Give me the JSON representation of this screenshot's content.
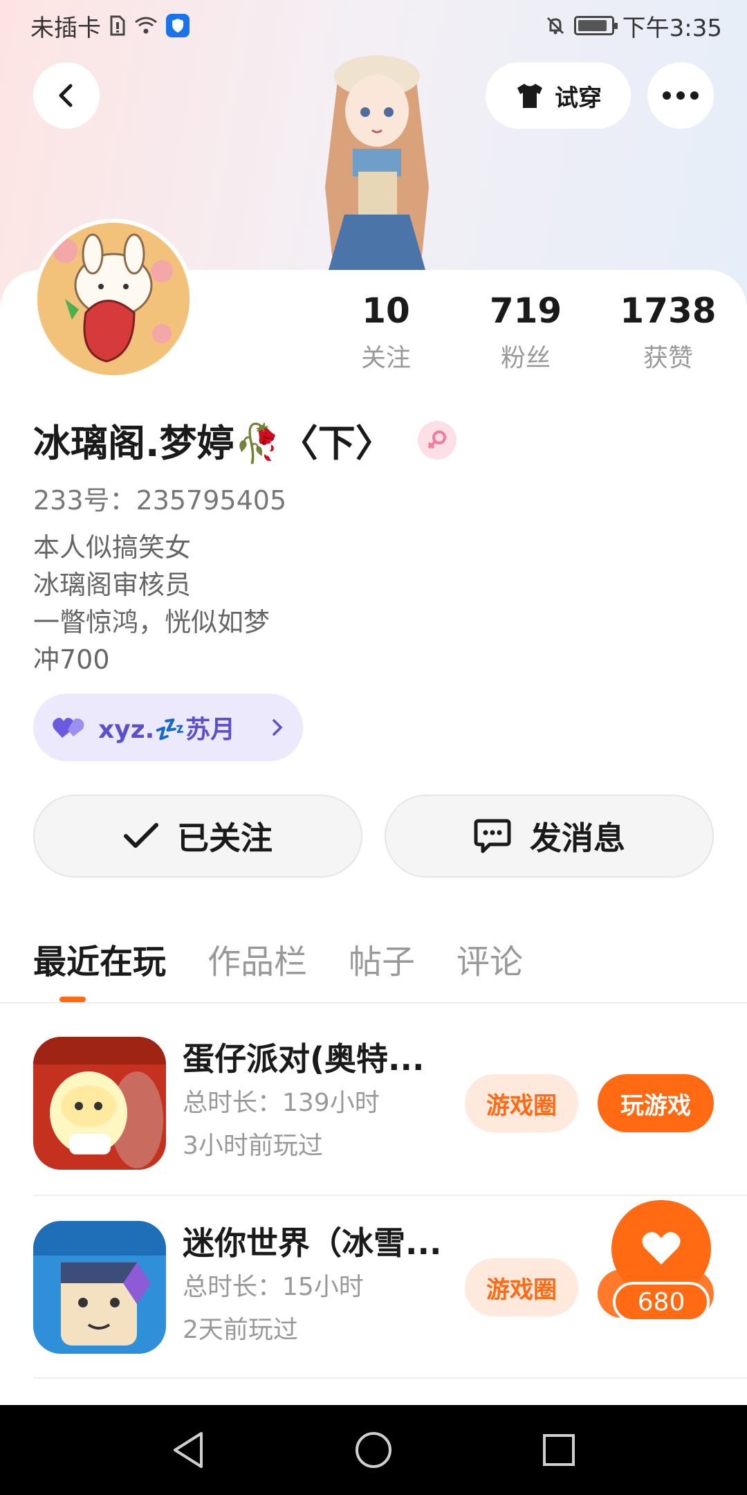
{
  "status_bar": {
    "carrier": "未插卡",
    "time": "下午3:35"
  },
  "header": {
    "try_on_label": "试穿"
  },
  "profile": {
    "name": "冰璃阁.梦婷🥀〈下〉",
    "uid": "233号：235795405",
    "bio": [
      "本人似搞笑女",
      "冰璃阁审核员",
      "一瞥惊鸿，恍似如梦",
      "冲700"
    ],
    "couple_name": "xyz.💤苏月"
  },
  "stats": [
    {
      "value": "10",
      "label": "关注"
    },
    {
      "value": "719",
      "label": "粉丝"
    },
    {
      "value": "1738",
      "label": "获赞"
    }
  ],
  "actions": {
    "follow_label": "已关注",
    "message_label": "发消息"
  },
  "tabs": [
    "最近在玩",
    "作品栏",
    "帖子",
    "评论"
  ],
  "games": [
    {
      "title": "蛋仔派对(奥特...",
      "duration": "总时长：139小时",
      "last_played": "3小时前玩过",
      "circle_label": "游戏圈",
      "play_label": "玩游戏"
    },
    {
      "title": "迷你世界（冰雪...",
      "duration": "总时长：15小时",
      "last_played": "2天前玩过",
      "circle_label": "游戏圈"
    }
  ],
  "like_fab": {
    "count": "680"
  },
  "colors": {
    "accent": "#ff6a13",
    "couple_text": "#5a4fcf"
  }
}
